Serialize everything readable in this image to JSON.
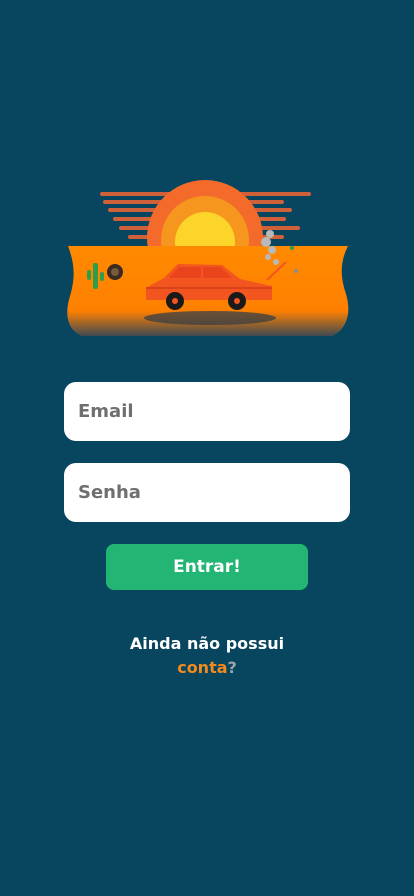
{
  "colors": {
    "background": "#07465e",
    "field_background": "#ffffff",
    "button_background": "#23b574",
    "link": "#f28a1e"
  },
  "hero": {
    "icon": "desert-broken-car-illustration"
  },
  "form": {
    "email_placeholder": "Email",
    "password_placeholder": "Senha",
    "email_value": "",
    "password_value": ""
  },
  "actions": {
    "login_label": "Entrar!"
  },
  "signup": {
    "prompt": "Ainda não possui",
    "link_label": "conta",
    "suffix": "?"
  }
}
